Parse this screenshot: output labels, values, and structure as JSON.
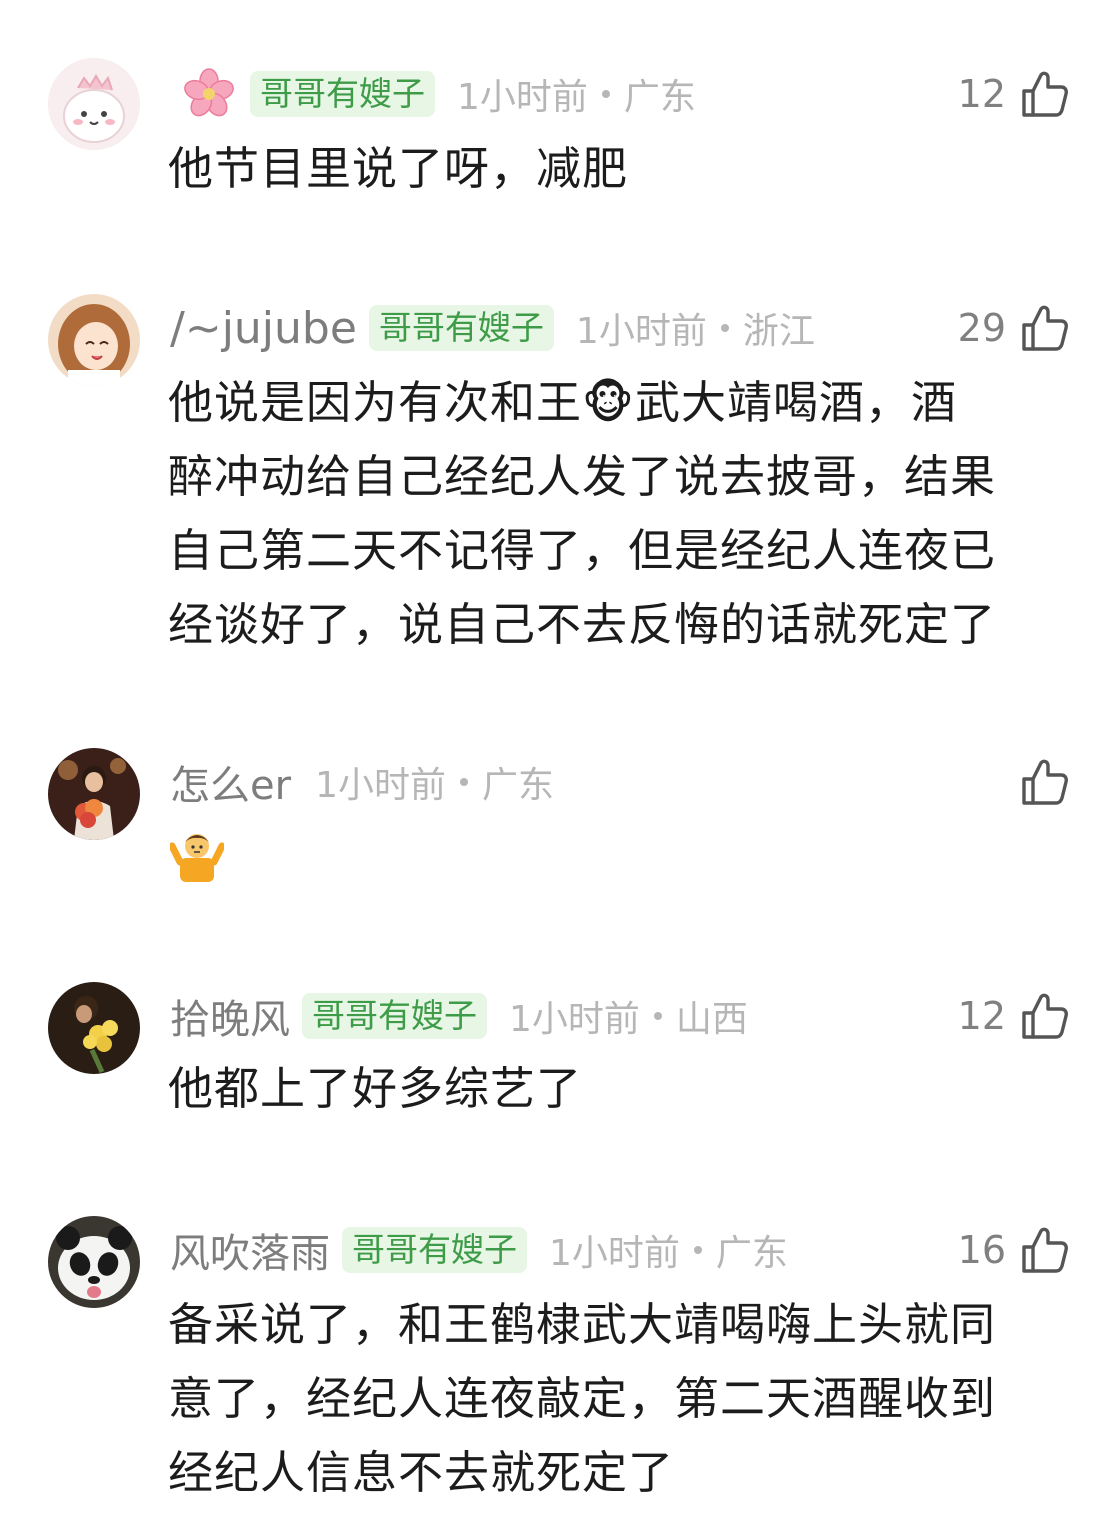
{
  "comments": [
    {
      "username": "",
      "has_flower_icon": true,
      "badge": "哥哥有嫂子",
      "time": "1小时前",
      "location": "广东",
      "likes": "12",
      "text": "他节目里说了呀，减肥"
    },
    {
      "username": "/~jujube",
      "badge": "哥哥有嫂子",
      "time": "1小时前",
      "location": "浙江",
      "likes": "29",
      "text_lines": [
        "他说是因为有次和王🐵武大靖喝酒，酒",
        "醉冲动给自己经纪人发了说去披哥，结果",
        "自己第二天不记得了，但是经纪人连夜已",
        "经谈好了，说自己不去反悔的话就死定了"
      ]
    },
    {
      "username": "怎么er",
      "time": "1小时前",
      "location": "广东",
      "likes": "",
      "emoji": "shrugging-person-emoji"
    },
    {
      "username": "拾晚风",
      "badge": "哥哥有嫂子",
      "time": "1小时前",
      "location": "山西",
      "likes": "12",
      "text": "他都上了好多综艺了"
    },
    {
      "username": "风吹落雨",
      "badge": "哥哥有嫂子",
      "time": "1小时前",
      "location": "广东",
      "likes": "16",
      "text_lines": [
        "备采说了，和王鹤棣武大靖喝嗨上头就同",
        "意了，经纪人连夜敲定，第二天酒醒收到",
        "经纪人信息不去就死定了"
      ]
    }
  ],
  "colors": {
    "badge_bg": "#e7f6e5",
    "badge_text": "#3e9b48",
    "meta": "#b6b6b6",
    "username": "#7d7d7d",
    "body": "#1c1c1c"
  },
  "icons": {
    "like": "thumbs-up-outline-icon",
    "flower": "cherry-blossom-icon"
  }
}
